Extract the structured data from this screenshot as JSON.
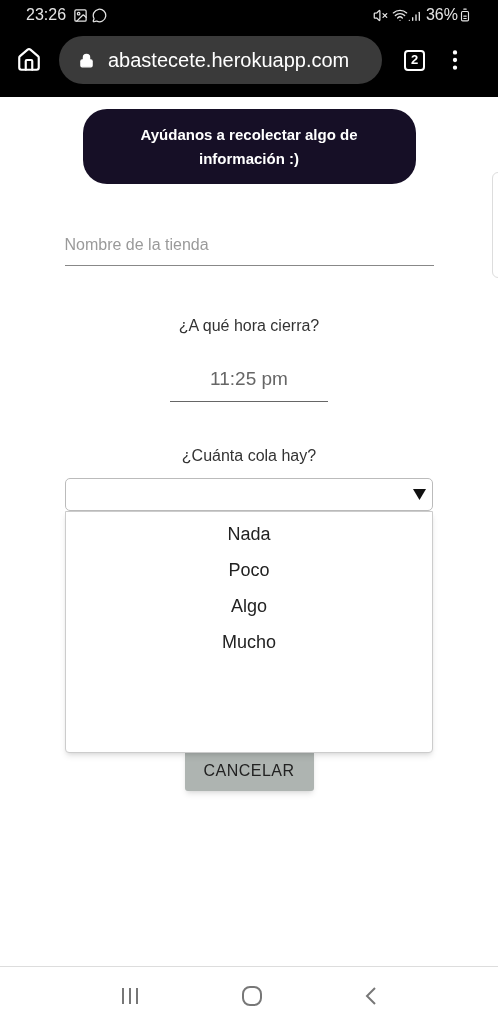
{
  "status_bar": {
    "time": "23:26",
    "battery": "36%"
  },
  "browser": {
    "url": "abastecete.herokuapp.com",
    "tab_count": "2"
  },
  "banner": {
    "text": "Ayúdanos a recolectar algo de información :)"
  },
  "form": {
    "store_name": {
      "placeholder": "Nombre de la tienda"
    },
    "closing_time": {
      "label": "¿A qué hora cierra?",
      "value": "11:25 pm"
    },
    "queue": {
      "label": "¿Cuánta cola hay?",
      "expanded": true,
      "options": [
        {
          "label": "Nada",
          "selected": false
        },
        {
          "label": "Poco",
          "selected": false
        },
        {
          "label": "Algo",
          "selected": false
        },
        {
          "label": "Mucho",
          "selected": false
        }
      ]
    },
    "cancel_button": "CANCELAR"
  }
}
